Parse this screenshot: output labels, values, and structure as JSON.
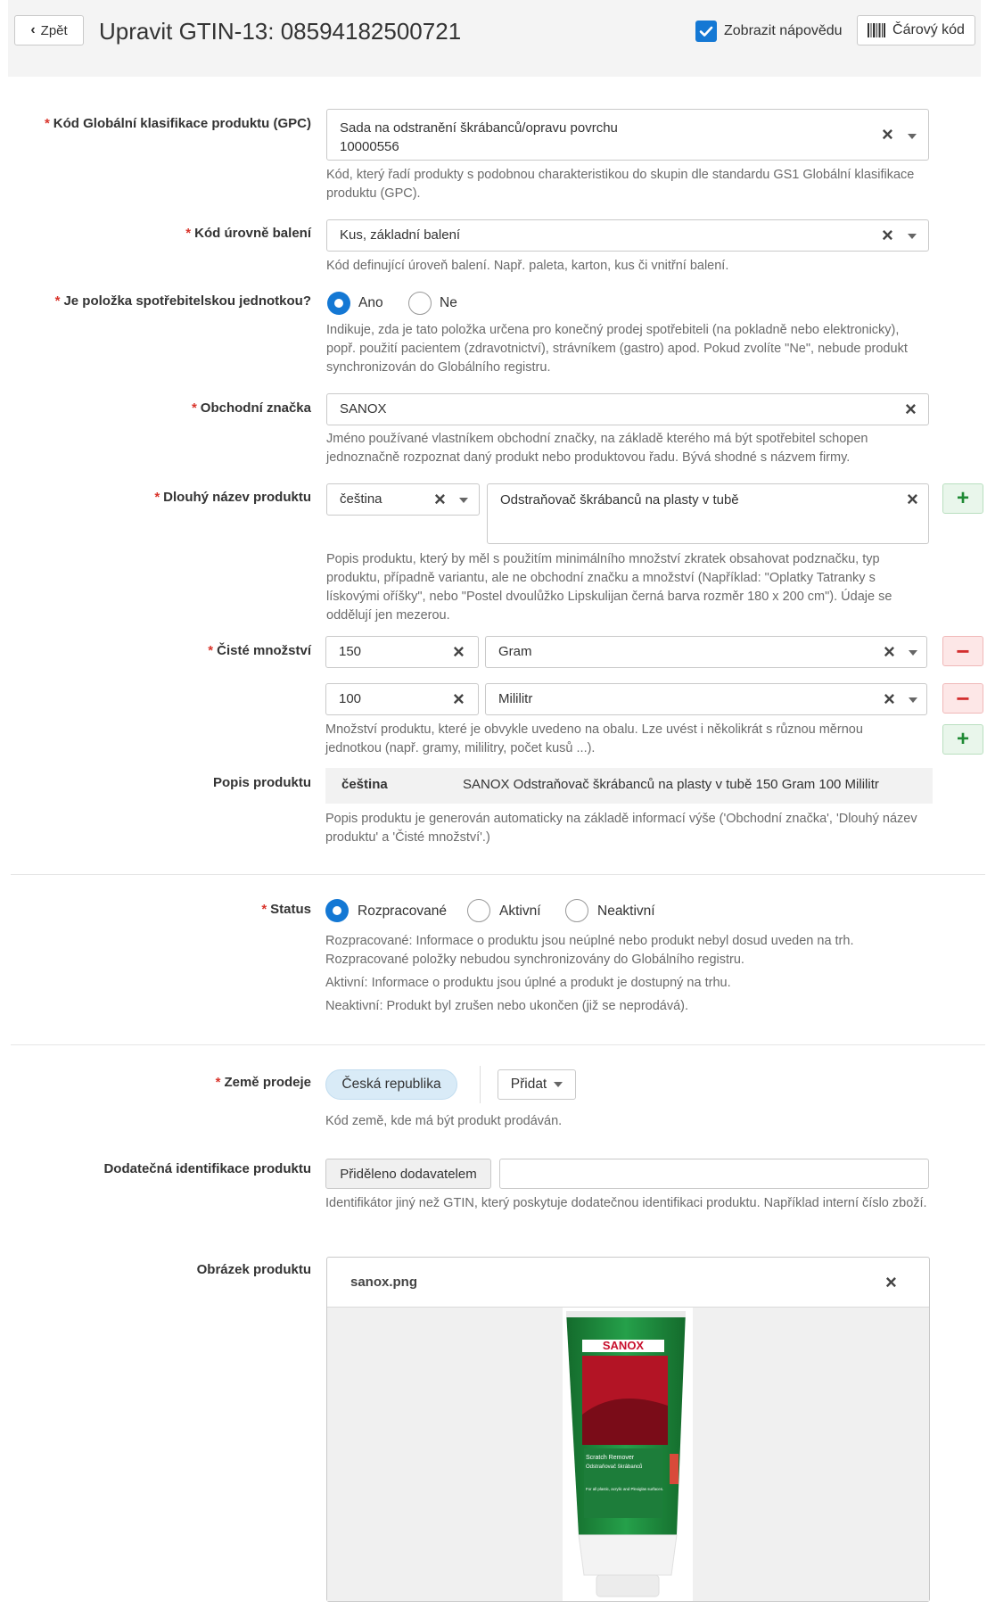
{
  "header": {
    "back_label": "Zpět",
    "title": "Upravit GTIN-13:  08594182500721",
    "help_label": "Zobrazit nápovědu",
    "barcode_label": "Čárový kód"
  },
  "gpc": {
    "label": "Kód Globální klasifikace produktu (GPC)",
    "value_line1": "Sada na odstranění škrábanců/opravu povrchu",
    "value_line2": "10000556",
    "help": "Kód, který řadí produkty s podobnou charakteristikou do skupin dle standardu GS1 Globální klasifikace produktu (GPC)."
  },
  "packaging": {
    "label": "Kód úrovně balení",
    "value": "Kus, základní balení",
    "help": "Kód definující úroveň balení. Např. paleta, karton, kus či vnitřní balení."
  },
  "consumer_unit": {
    "label": "Je položka spotřebitelskou jednotkou?",
    "yes": "Ano",
    "no": "Ne",
    "selected": "Ano",
    "help": "Indikuje, zda je tato položka určena pro konečný prodej spotřebiteli (na pokladně nebo elektronicky), popř. použití pacientem (zdravotnictví), strávníkem (gastro) apod. Pokud zvolíte \"Ne\", nebude produkt synchronizován do Globálního registru."
  },
  "brand": {
    "label": "Obchodní značka",
    "value": "SANOX",
    "help": "Jméno používané vlastníkem obchodní značky, na základě kterého má být spotřebitel schopen jednoznačně rozpoznat daný produkt nebo produktovou řadu. Bývá shodné s názvem firmy."
  },
  "long_name": {
    "label": "Dlouhý název produktu",
    "language": "čeština",
    "value": "Odstraňovač škrábanců na plasty v tubě",
    "help": "Popis produktu, který by měl s použitím minimálního množství zkratek obsahovat podznačku, typ produktu, případně variantu, ale ne obchodní značku a množství (Například: \"Oplatky Tatranky s lískovými oříšky\", nebo \"Postel dvoulůžko Lipskulijan černá barva rozměr 180 x 200 cm\"). Údaje se oddělují jen mezerou."
  },
  "net_content": {
    "label": "Čisté množství",
    "rows": [
      {
        "amount": "150",
        "unit": "Gram"
      },
      {
        "amount": "100",
        "unit": "Mililitr"
      }
    ],
    "help": "Množství produktu, které je obvykle uvedeno na obalu. Lze uvést i několikrát s různou měrnou jednotkou (např. gramy, mililitry, počet kusů ...)."
  },
  "description": {
    "label": "Popis produktu",
    "language": "čeština",
    "value": "SANOX Odstraňovač škrábanců na plasty v tubě 150 Gram 100 Mililitr",
    "help": "Popis produktu je generován automaticky na základě informací výše ('Obchodní značka', 'Dlouhý název produktu' a 'Čisté množství'.)"
  },
  "status": {
    "label": "Status",
    "options": [
      "Rozpracované",
      "Aktivní",
      "Neaktivní"
    ],
    "selected": "Rozpracované",
    "help_1": "Rozpracované: Informace o produktu jsou neúplné nebo produkt nebyl dosud uveden na trh. Rozpracované položky nebudou synchronizovány do Globálního registru.",
    "help_2": "Aktivní: Informace o produktu jsou úplné a produkt je dostupný na trhu.",
    "help_3": "Neaktivní: Produkt byl zrušen nebo ukončen (již se neprodává)."
  },
  "countries": {
    "label": "Země prodeje",
    "chip": "Česká republika",
    "add_label": "Přidat",
    "help": "Kód země, kde má být produkt prodáván."
  },
  "additional_id": {
    "label": "Dodatečná identifikace produktu",
    "type_label": "Přiděleno dodavatelem",
    "value": "",
    "help": "Identifikátor jiný než GTIN, který poskytuje dodatečnou identifikaci produktu. Například interní číslo zboží."
  },
  "image": {
    "label": "Obrázek produktu",
    "filename": "sanox.png",
    "brand_text": "SANOX",
    "tube_text_1": "Scratch Remover",
    "tube_text_2": "Odstraňovač škrábanců",
    "tube_text_3": "For all plastic, acrylic and Plexiglas surfaces."
  },
  "colors": {
    "accent": "#1478d4",
    "required": "#d9342b",
    "tube_green": "#1e8a3c",
    "tube_red": "#c8102e"
  }
}
